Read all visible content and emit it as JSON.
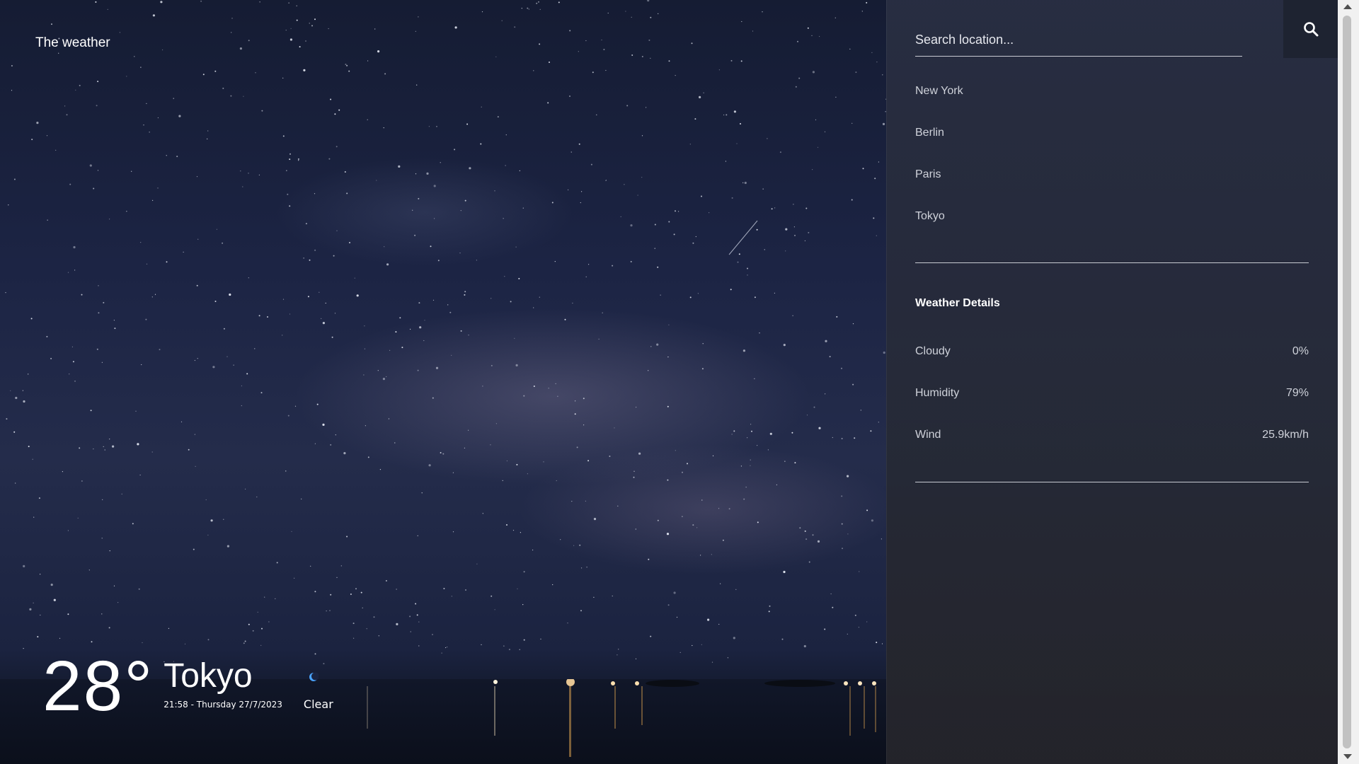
{
  "app": {
    "brand": "The weather"
  },
  "current": {
    "temperature": "28°",
    "city": "Tokyo",
    "datetime": "21:58 - Thursday 27/7/2023",
    "condition": "Clear",
    "condition_icon": "moon-icon"
  },
  "search": {
    "placeholder": "Search location...",
    "button_icon": "search-icon"
  },
  "locations": [
    "New York",
    "Berlin",
    "Paris",
    "Tokyo"
  ],
  "details": {
    "title": "Weather Details",
    "rows": [
      {
        "label": "Cloudy",
        "value": "0%"
      },
      {
        "label": "Humidity",
        "value": "79%"
      },
      {
        "label": "Wind",
        "value": "25.9km/h"
      }
    ]
  }
}
